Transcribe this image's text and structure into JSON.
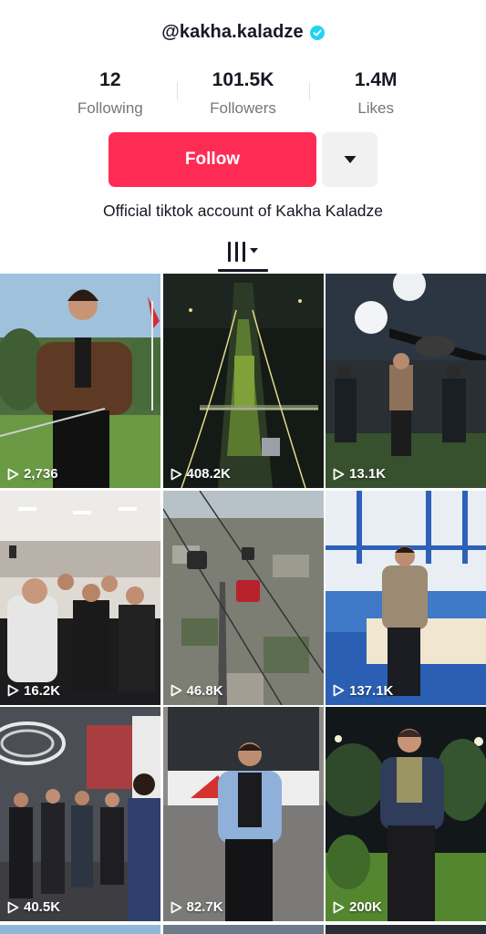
{
  "profile": {
    "username": "@kakha.kaladze",
    "verified": true,
    "bio": "Official tiktok account of Kakha Kaladze"
  },
  "stats": [
    {
      "value": "12",
      "label": "Following"
    },
    {
      "value": "101.5K",
      "label": "Followers"
    },
    {
      "value": "1.4M",
      "label": "Likes"
    }
  ],
  "actions": {
    "follow_label": "Follow",
    "more_icon": "caret-down-icon"
  },
  "tabs": {
    "active_icon": "videos-grid-icon"
  },
  "colors": {
    "accent": "#fe2c55",
    "verified": "#20d5ec",
    "secondary_button": "#f1f1f2"
  },
  "videos": [
    {
      "views": "2,736"
    },
    {
      "views": "408.2K"
    },
    {
      "views": "13.1K"
    },
    {
      "views": "16.2K"
    },
    {
      "views": "46.8K"
    },
    {
      "views": "137.1K"
    },
    {
      "views": "40.5K"
    },
    {
      "views": "82.7K"
    },
    {
      "views": "200K"
    }
  ]
}
